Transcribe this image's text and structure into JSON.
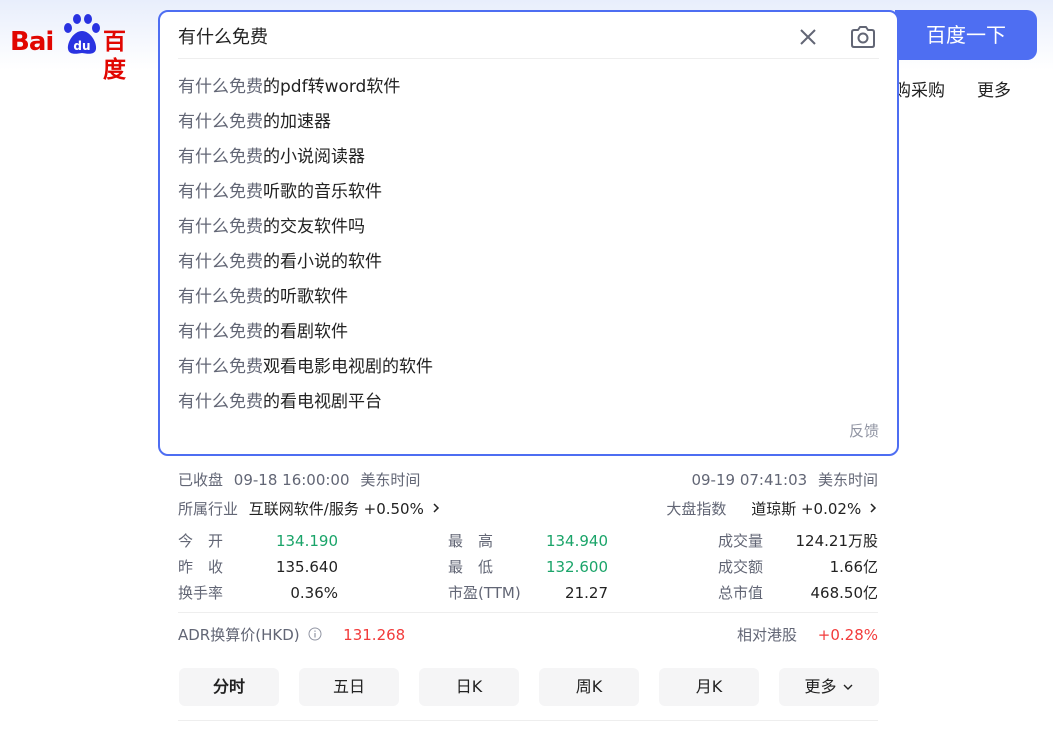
{
  "logo": {
    "text_latin": "Bai",
    "text_du": "du",
    "text_cn": "百度"
  },
  "search": {
    "query": "有什么免费",
    "button_label": "百度一下",
    "suggestions": [
      {
        "prefix": "有什么免费",
        "suffix": "的pdf转word软件"
      },
      {
        "prefix": "有什么免费",
        "suffix": "的加速器"
      },
      {
        "prefix": "有什么免费",
        "suffix": "的小说阅读器"
      },
      {
        "prefix": "有什么免费",
        "suffix": "听歌的音乐软件"
      },
      {
        "prefix": "有什么免费",
        "suffix": "的交友软件吗"
      },
      {
        "prefix": "有什么免费",
        "suffix": "的看小说的软件"
      },
      {
        "prefix": "有什么免费",
        "suffix": "的听歌软件"
      },
      {
        "prefix": "有什么免费",
        "suffix": "的看剧软件"
      },
      {
        "prefix": "有什么免费",
        "suffix": "观看电影电视剧的软件"
      },
      {
        "prefix": "有什么免费",
        "suffix": "的看电视剧平台"
      }
    ],
    "feedback_label": "反馈"
  },
  "top_nav": {
    "partial_label": "购采购",
    "more_label": "更多"
  },
  "stock": {
    "closed_status": "已收盘",
    "closed_time": "09-18 16:00:00",
    "closed_tz": "美东时间",
    "premarket_time": "09-19 07:41:03",
    "premarket_tz": "美东时间",
    "industry_label": "所属行业",
    "industry_value": "互联网软件/服务 +0.50%",
    "market_index_label": "大盘指数",
    "market_index_value": "道琼斯 +0.02%",
    "stats": {
      "open": {
        "label": "今　开",
        "value": "134.190"
      },
      "prev_close": {
        "label": "昨　收",
        "value": "135.640"
      },
      "turnover": {
        "label": "换手率",
        "value": "0.36%"
      },
      "high": {
        "label": "最　高",
        "value": "134.940"
      },
      "low": {
        "label": "最　低",
        "value": "132.600"
      },
      "pe": {
        "label": "市盈(TTM)",
        "value": "21.27"
      },
      "volume": {
        "label": "成交量",
        "value": "124.21万股"
      },
      "amount": {
        "label": "成交额",
        "value": "1.66亿"
      },
      "market_cap": {
        "label": "总市值",
        "value": "468.50亿"
      }
    },
    "adr_label": "ADR换算价(HKD)",
    "adr_value": "131.268",
    "hk_relative_label": "相对港股",
    "hk_relative_value": "+0.28%",
    "period_tabs": [
      "分时",
      "五日",
      "日K",
      "周K",
      "月K",
      "更多"
    ],
    "active_tab": 0
  },
  "colors": {
    "accent": "#4e6ef2",
    "brand_red": "#e10601",
    "up_red": "#f23b3b",
    "down_green": "#1aa469"
  }
}
